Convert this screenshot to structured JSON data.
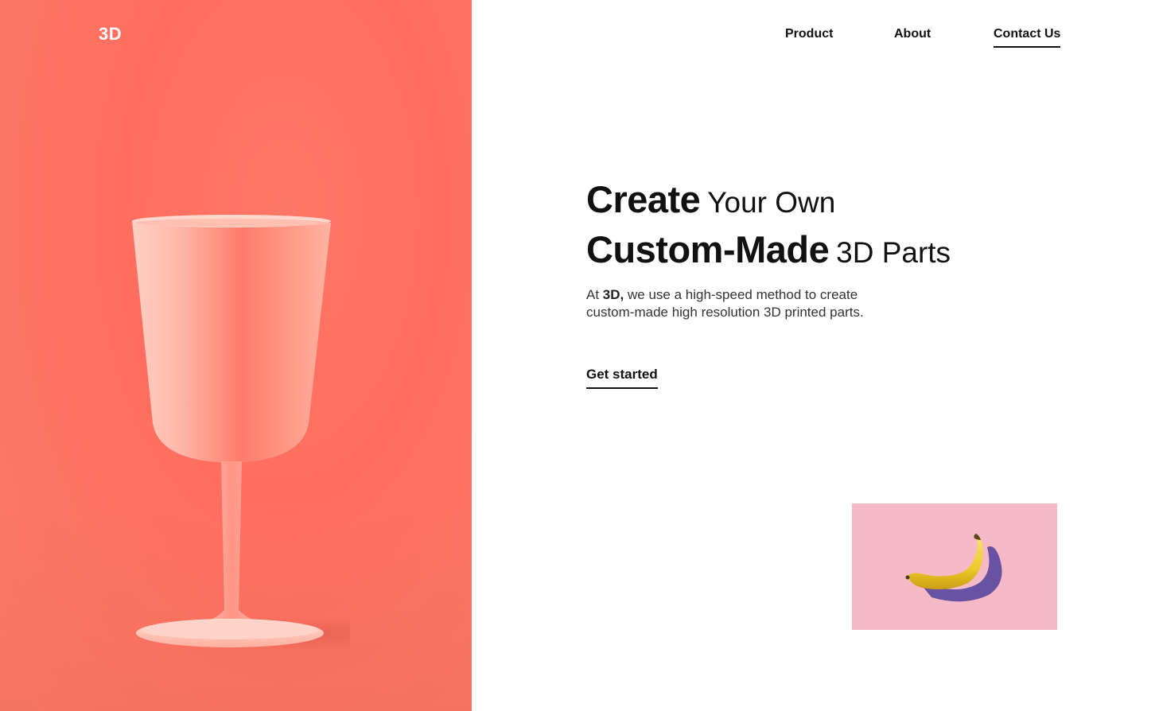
{
  "brand": {
    "logo": "3D",
    "accent": "#ff6e5e",
    "card_color": "#f6b9c6"
  },
  "nav": {
    "items": [
      {
        "label": "Product"
      },
      {
        "label": "About"
      },
      {
        "label": "Contact Us",
        "active": true
      }
    ]
  },
  "hero": {
    "headline_line1_bold": "Create",
    "headline_line1_light": "Your Own",
    "headline_line2_bold": "Custom-Made",
    "headline_line2_light": "3D Parts",
    "description_prefix": "At ",
    "description_brand": "3D,",
    "description_rest": " we use a high-speed method to create custom-made high resolution 3D printed parts.",
    "cta_label": "Get started"
  },
  "images": {
    "hero_image": "pink-wine-glass",
    "card_image": "banana-on-pink"
  }
}
